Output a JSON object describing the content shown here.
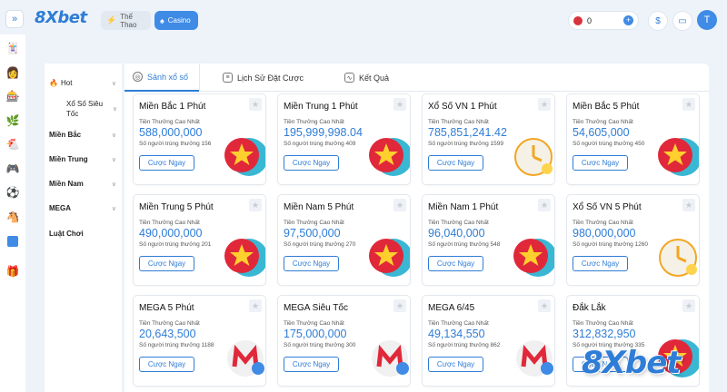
{
  "header": {
    "logo": "8Xbet",
    "sport_tab": "Thể Thao",
    "casino_tab": "Casino",
    "balance": "0",
    "avatar_initial": "T"
  },
  "rail": {
    "icons": [
      "collapse-icon",
      "cards-icon",
      "person-icon",
      "slot-icon",
      "leaf-icon",
      "chicken-icon",
      "gamepad-icon",
      "ball-icon",
      "horse-icon",
      "list-icon",
      "gift-icon"
    ]
  },
  "categories": {
    "hot": "Hot",
    "sieu_toc": "Xổ Số Siêu Tốc",
    "mien_bac": "Miền Bắc",
    "mien_trung": "Miền Trung",
    "mien_nam": "Miền Nam",
    "mega": "MEGA",
    "luat_choi": "Luật Chơi"
  },
  "tabs": {
    "lottery": "Sảnh xổ số",
    "history": "Lịch Sử Đặt Cược",
    "results": "Kết Quả"
  },
  "card_common": {
    "prize_label": "Tiền Thưởng Cao Nhất",
    "bet_label": "Cược Ngay"
  },
  "cards": [
    {
      "title": "Miền Bắc 1 Phút",
      "prize": "588,000,000",
      "winners": "Số người trúng thưởng 156",
      "badge": "star"
    },
    {
      "title": "Miền Trung 1 Phút",
      "prize": "195,999,998.04",
      "winners": "Số người trúng thưởng 409",
      "badge": "star"
    },
    {
      "title": "Xổ Số VN 1 Phút",
      "prize": "785,851,241.42",
      "winners": "Số người trúng thưởng 1599",
      "badge": "clock"
    },
    {
      "title": "Miền Bắc 5 Phút",
      "prize": "54,605,000",
      "winners": "Số người trúng thưởng 450",
      "badge": "star"
    },
    {
      "title": "Miền Trung 5 Phút",
      "prize": "490,000,000",
      "winners": "Số người trúng thưởng 201",
      "badge": "star"
    },
    {
      "title": "Miền Nam 5 Phút",
      "prize": "97,500,000",
      "winners": "Số người trúng thưởng 270",
      "badge": "star"
    },
    {
      "title": "Miền Nam 1 Phút",
      "prize": "96,040,000",
      "winners": "Số người trúng thưởng 548",
      "badge": "star"
    },
    {
      "title": "Xổ Số VN 5 Phút",
      "prize": "980,000,000",
      "winners": "Số người trúng thưởng 1260",
      "badge": "clock"
    },
    {
      "title": "MEGA 5 Phút",
      "prize": "20,643,500",
      "winners": "Số người trúng thưởng 1188",
      "badge": "mega"
    },
    {
      "title": "MEGA Siêu Tốc",
      "prize": "175,000,000",
      "winners": "Số người trúng thưởng 300",
      "badge": "mega"
    },
    {
      "title": "MEGA 6/45",
      "prize": "49,134,550",
      "winners": "Số người trúng thưởng 862",
      "badge": "mega"
    },
    {
      "title": "Đắk Lắk",
      "prize": "312,832,950",
      "winners": "Số người trúng thưởng 335",
      "badge": "star"
    }
  ],
  "watermark": "8Xbet"
}
